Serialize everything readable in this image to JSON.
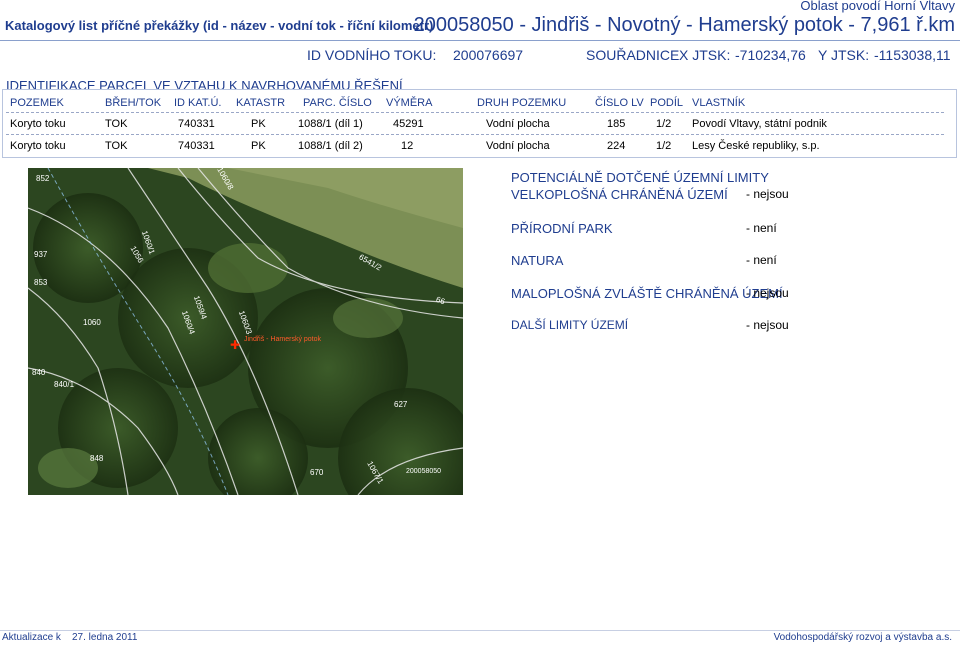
{
  "header": {
    "region": "Oblast povodí Horní Vltavy",
    "title": "Katalogový list příčné překážky (id - název - vodní tok - říční kilometr)",
    "identifier": "200058050 - Jindřiš - Novotný - Hamerský potok - 7,961 ř.km"
  },
  "info": {
    "id_label": "ID VODNÍHO TOKU:",
    "id_value": "200076697",
    "coord_label": "SOUŘADNICE",
    "x_label": "X JTSK:",
    "x_value": "-710234,76",
    "y_label": "Y JTSK:",
    "y_value": "-1153038,11"
  },
  "parcels": {
    "heading": "IDENTIFIKACE PARCEL VE VZTAHU K NAVRHOVANÉMU ŘEŠENÍ",
    "columns": [
      "POZEMEK",
      "BŘEH/TOK",
      "ID KAT.Ú.",
      "KATASTR",
      "PARC. ČÍSLO",
      "VÝMĚRA",
      "DRUH POZEMKU",
      "ČÍSLO LV",
      "PODÍL",
      "VLASTNÍK"
    ],
    "rows": [
      [
        "Koryto toku",
        "TOK",
        "740331",
        "PK",
        "1088/1 (díl 1)",
        "45291",
        "Vodní plocha",
        "185",
        "1/2",
        "Povodí Vltavy, státní podnik"
      ],
      [
        "Koryto toku",
        "TOK",
        "740331",
        "PK",
        "1088/1 (díl 2)",
        "12",
        "Vodní plocha",
        "224",
        "1/2",
        "Lesy České republiky, s.p."
      ]
    ]
  },
  "map": {
    "labels": [
      "852",
      "1060/8",
      "1060/1",
      "937",
      "1056",
      "6541/2",
      "66",
      "853",
      "1059/4",
      "1060/3",
      "1060/4",
      "1060",
      "840",
      "840/1",
      "848",
      "627",
      "670",
      "1067/1",
      "200058050",
      "Jindřiš - Hamerský potok"
    ]
  },
  "limits": {
    "title": "POTENCIÁLNĚ DOTČENÉ ÚZEMNÍ LIMITY",
    "items": [
      {
        "label": "VELKOPLOŠNÁ CHRÁNĚNÁ ÚZEMÍ",
        "value": "- nejsou"
      },
      {
        "label": "PŘÍRODNÍ PARK",
        "value": "- není"
      },
      {
        "label": "NATURA",
        "value": "- není"
      },
      {
        "label": "MALOPLOŠNÁ ZVLÁŠTĚ CHRÁNĚNÁ ÚZEMÍ",
        "value": "- nejsou"
      },
      {
        "label": "DALŠÍ LIMITY ÚZEMÍ",
        "value": "- nejsou"
      }
    ]
  },
  "footer": {
    "update_label": "Aktualizace k",
    "update_date": "27. ledna 2011",
    "author": "Vodohospodářský rozvoj a výstavba a.s."
  },
  "colors": {
    "accent": "#1f3d8f",
    "cross": "#ff2a00"
  }
}
